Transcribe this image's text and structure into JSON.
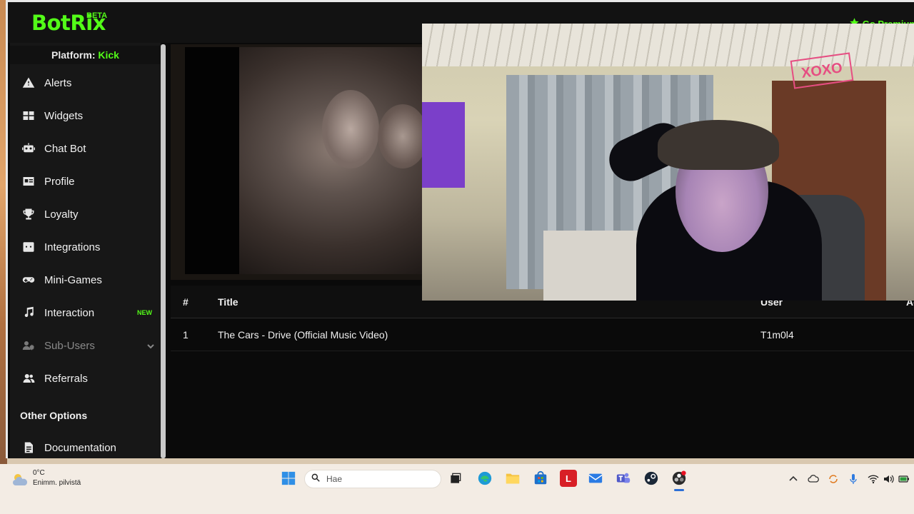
{
  "app": {
    "logo": "BotRix",
    "logo_badge": "BETA",
    "go_premium": "Go Premium",
    "brand_color": "#53fc18"
  },
  "sidebar": {
    "platform_label": "Platform:",
    "platform_value": "Kick",
    "items": [
      {
        "label": "Alerts",
        "icon": "warning-icon"
      },
      {
        "label": "Widgets",
        "icon": "widgets-icon"
      },
      {
        "label": "Chat Bot",
        "icon": "robot-icon"
      },
      {
        "label": "Profile",
        "icon": "id-card-icon"
      },
      {
        "label": "Loyalty",
        "icon": "trophy-icon"
      },
      {
        "label": "Integrations",
        "icon": "discord-icon"
      },
      {
        "label": "Mini-Games",
        "icon": "gamepad-icon"
      },
      {
        "label": "Interaction",
        "icon": "music-icon",
        "badge": "NEW"
      },
      {
        "label": "Sub-Users",
        "icon": "users-cog-icon"
      },
      {
        "label": "Referrals",
        "icon": "users-icon"
      }
    ],
    "other_options_title": "Other Options",
    "other_items": [
      {
        "label": "Documentation",
        "icon": "document-icon"
      }
    ]
  },
  "table": {
    "headers": {
      "num": "#",
      "title": "Title",
      "user": "User",
      "action": "Ac"
    },
    "rows": [
      {
        "num": "1",
        "title": "The Cars - Drive (Official Music Video)",
        "user": "T1m0l4"
      }
    ]
  },
  "webcam": {
    "sign_text": "XOXO"
  },
  "taskbar": {
    "weather_temp": "0°C",
    "weather_desc": "Enimm. pilvistä",
    "search_placeholder": "Hae",
    "apps": [
      "windows-start-icon",
      "task-view-icon",
      "edge-icon",
      "file-explorer-icon",
      "store-icon",
      "l-app-icon",
      "mail-icon",
      "teams-icon",
      "steam-icon",
      "obs-icon"
    ]
  }
}
